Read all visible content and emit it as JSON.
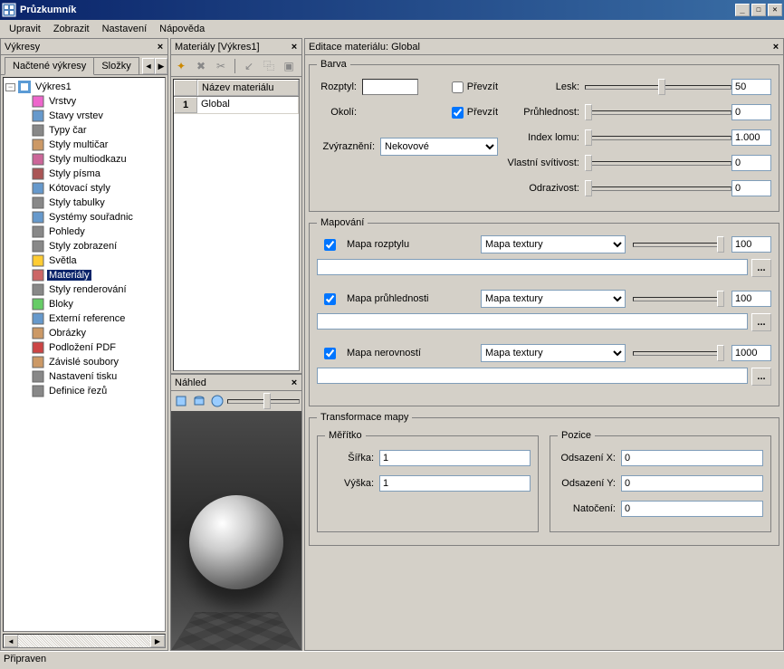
{
  "window": {
    "title": "Průzkumník"
  },
  "menu": [
    "Upravit",
    "Zobrazit",
    "Nastavení",
    "Nápověda"
  ],
  "panels": {
    "drawings": "Výkresy",
    "materials": "Materiály [Výkres1]",
    "preview": "Náhled",
    "editor": "Editace materiálu: Global"
  },
  "tabs": {
    "loaded": "Načtené výkresy",
    "folders": "Složky"
  },
  "tree": {
    "root": "Výkres1",
    "items": [
      "Vrstvy",
      "Stavy vrstev",
      "Typy čar",
      "Styly multičar",
      "Styly multiodkazu",
      "Styly písma",
      "Kótovací styly",
      "Styly tabulky",
      "Systémy souřadnic",
      "Pohledy",
      "Styly zobrazení",
      "Světla",
      "Materiály",
      "Styly renderování",
      "Bloky",
      "Externí reference",
      "Obrázky",
      "Podložení PDF",
      "Závislé soubory",
      "Nastavení tisku",
      "Definice řezů"
    ]
  },
  "grid": {
    "hdr_num": "",
    "hdr_name": "Název materiálu",
    "row_num": "1",
    "row_name": "Global"
  },
  "barva": {
    "legend": "Barva",
    "rozptyl": "Rozptyl:",
    "okoli": "Okolí:",
    "prevzit": "Převzít",
    "zvyrazneni": "Zvýraznění:",
    "zvyr_val": "Nekovové",
    "lesk": "Lesk:",
    "lesk_val": "50",
    "pruhlednost": "Průhlednost:",
    "pruhlednost_val": "0",
    "index_lomu": "Index lomu:",
    "index_lomu_val": "1.000",
    "svitivost": "Vlastní svítivost:",
    "svitivost_val": "0",
    "odrazivost": "Odrazivost:",
    "odrazivost_val": "0"
  },
  "mapovani": {
    "legend": "Mapování",
    "rozptyl": "Mapa rozptylu",
    "rozptyl_val": "100",
    "pruhlednost": "Mapa průhlednosti",
    "pruhlednost_val": "100",
    "nerovnosti": "Mapa nerovností",
    "nerovnosti_val": "1000",
    "textura": "Mapa textury",
    "browse": "..."
  },
  "transform": {
    "legend": "Transformace mapy",
    "meritko": "Měřítko",
    "sirka": "Šířka:",
    "sirka_val": "1",
    "vyska": "Výška:",
    "vyska_val": "1",
    "pozice": "Pozice",
    "ox": "Odsazení X:",
    "ox_val": "0",
    "oy": "Odsazení Y:",
    "oy_val": "0",
    "natoceni": "Natočení:",
    "natoceni_val": "0"
  },
  "status": "Připraven"
}
